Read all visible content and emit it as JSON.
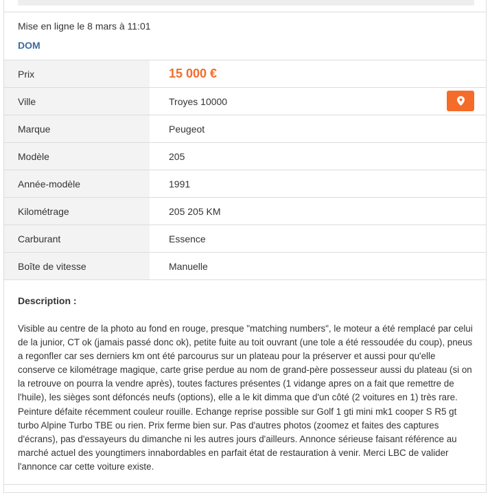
{
  "listing": {
    "posted_date": "Mise en ligne le 8 mars à 11:01",
    "category": "DOM"
  },
  "attributes": [
    {
      "label": "Prix",
      "value": "15 000 €"
    },
    {
      "label": "Ville",
      "value": "Troyes 10000"
    },
    {
      "label": "Marque",
      "value": "Peugeot"
    },
    {
      "label": "Modèle",
      "value": "205"
    },
    {
      "label": "Année-modèle",
      "value": "1991"
    },
    {
      "label": "Kilométrage",
      "value": "205 205 KM"
    },
    {
      "label": "Carburant",
      "value": "Essence"
    },
    {
      "label": "Boîte de vitesse",
      "value": "Manuelle"
    }
  ],
  "location_button": {
    "icon": "map-pin-icon",
    "color": "#f56b2a"
  },
  "colors": {
    "accent": "#f56b2a",
    "category": "#3d6a9e",
    "label_bg": "#f3f3f3"
  },
  "description": {
    "title": "Description :",
    "text": "Visible au centre de la photo au fond en rouge, presque \"matching numbers\", le moteur a été remplacé par celui de la junior, CT ok (jamais passé donc ok), petite fuite au toit ouvrant (une tole a été ressoudée du coup), pneus a regonfler car ses derniers km ont été parcourus sur un plateau pour la préserver et aussi pour qu'elle conserve ce kilométrage magique, carte grise perdue au nom de grand-père possesseur aussi du plateau (si on la retrouve on pourra la vendre après), toutes factures présentes (1 vidange apres on a fait que remettre de l'huile), les sièges sont défoncés neufs (options), elle a le kit dimma que d'un côté (2 voitures en 1) très rare. Peinture défaite récemment couleur rouille. Echange reprise possible sur Golf 1 gti mini mk1 cooper S R5 gt turbo Alpine Turbo TBE ou rien. Prix ferme bien sur. Pas d'autres photos (zoomez et faites des captures d'écrans), pas d'essayeurs du dimanche ni les autres jours d'ailleurs. Annonce sérieuse faisant référence au marché actuel des youngtimers innabordables en parfait état de restauration à venir. Merci LBC de valider l'annonce car cette voiture existe."
  }
}
